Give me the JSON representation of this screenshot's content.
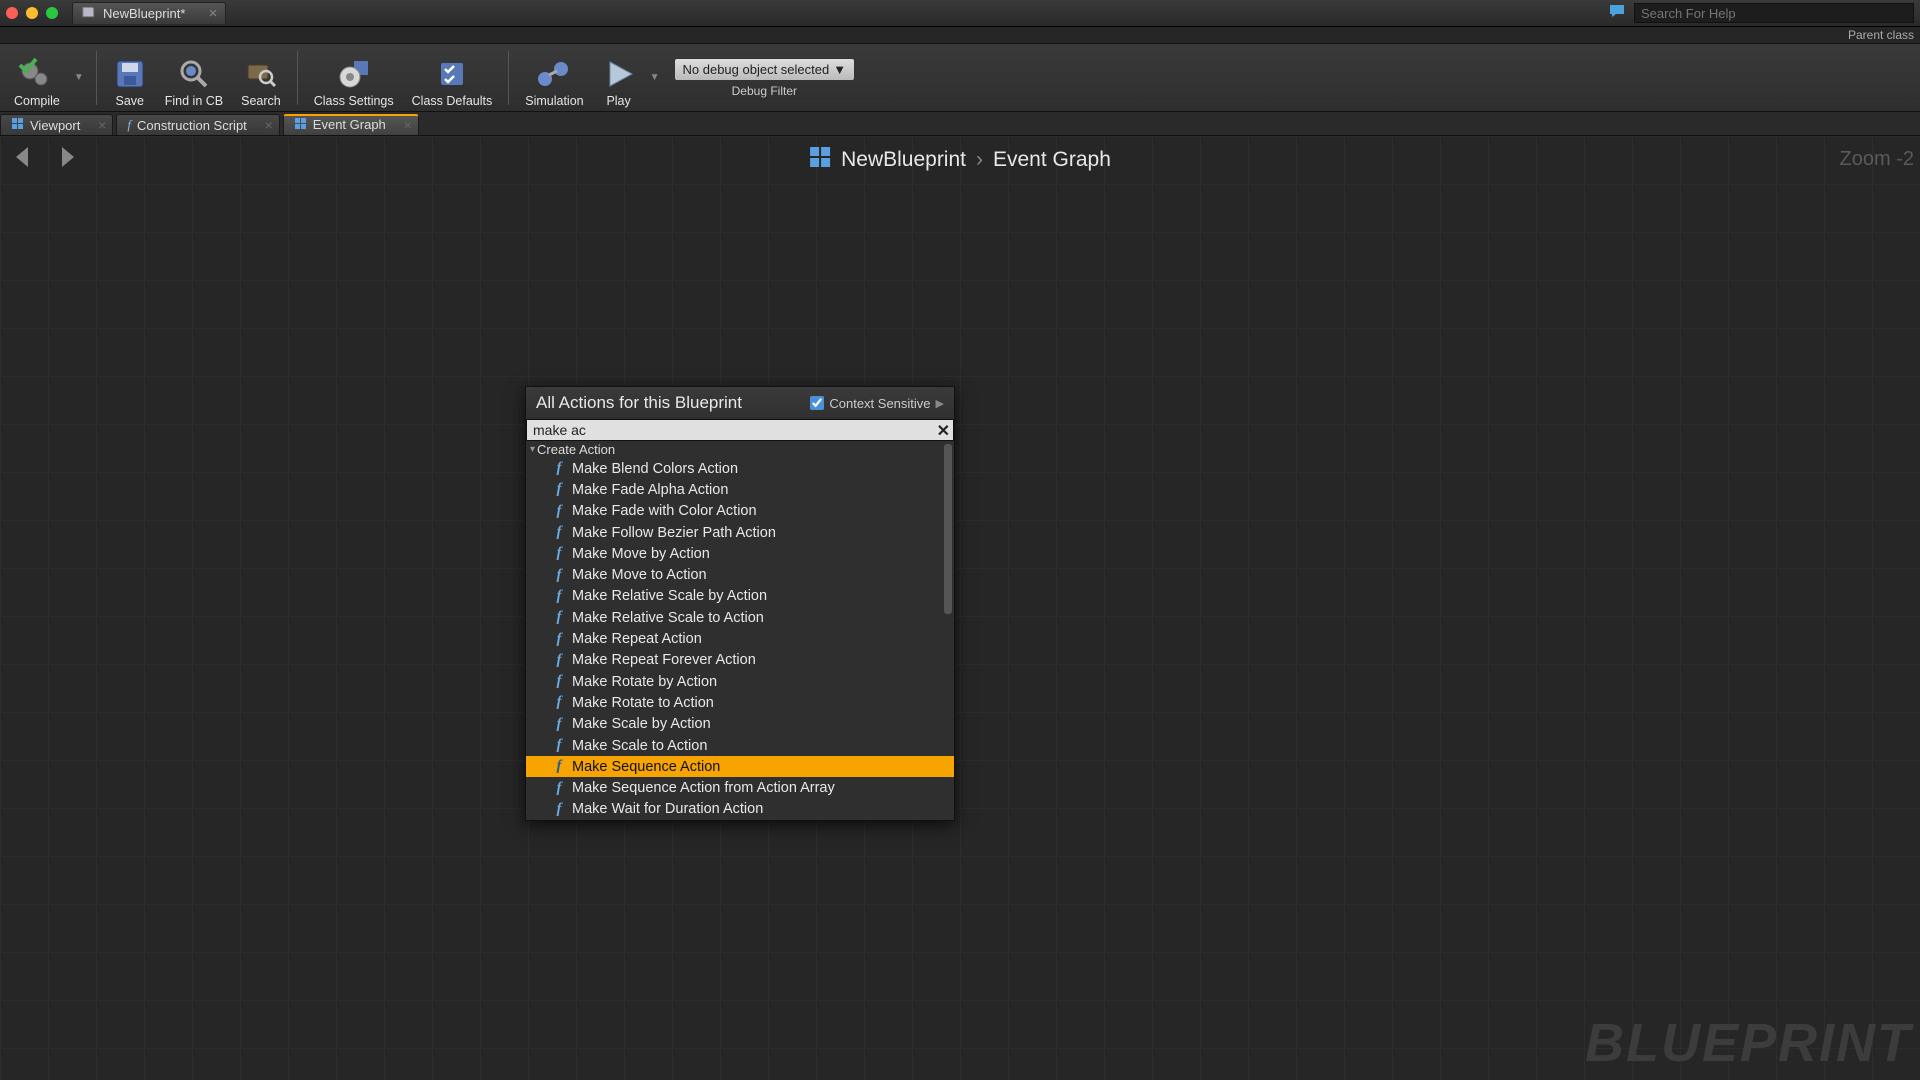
{
  "titlebar": {
    "document_name": "NewBlueprint*",
    "search_placeholder": "Search For Help"
  },
  "parent_strip": "Parent class",
  "toolbar": {
    "compile": "Compile",
    "save": "Save",
    "find": "Find in CB",
    "search": "Search",
    "class_settings": "Class Settings",
    "class_defaults": "Class Defaults",
    "simulation": "Simulation",
    "play": "Play",
    "debug_selected": "No debug object selected",
    "debug_label": "Debug Filter"
  },
  "subtabs": {
    "viewport": "Viewport",
    "construction": "Construction Script",
    "event_graph": "Event Graph"
  },
  "graph": {
    "breadcrumb_root": "NewBlueprint",
    "breadcrumb_leaf": "Event Graph",
    "zoom": "Zoom -2",
    "watermark": "BLUEPRINT"
  },
  "context_menu": {
    "title": "All Actions for this Blueprint",
    "sensitive_label": "Context Sensitive",
    "search_value": "make ac",
    "category": "Create Action",
    "items": [
      "Make Blend Colors Action",
      "Make Fade Alpha Action",
      "Make Fade with Color Action",
      "Make Follow Bezier Path Action",
      "Make Move by Action",
      "Make Move to Action",
      "Make Relative Scale by Action",
      "Make Relative Scale to Action",
      "Make Repeat Action",
      "Make Repeat Forever Action",
      "Make Rotate by Action",
      "Make Rotate to Action",
      "Make Scale by Action",
      "Make Scale to Action",
      "Make Sequence Action",
      "Make Sequence Action from Action Array",
      "Make Wait for Duration Action"
    ],
    "selected_index": 14
  }
}
